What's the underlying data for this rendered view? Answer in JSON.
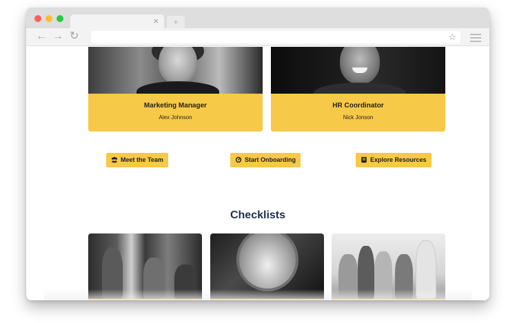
{
  "browser": {
    "tab_close": "×",
    "new_tab": "+",
    "nav": {
      "back": "←",
      "forward": "→",
      "reload": "↻"
    },
    "bookmark_icon": "☆"
  },
  "profiles": [
    {
      "title": "Marketing Manager",
      "name": "Alex Johnson"
    },
    {
      "title": "HR Coordinator",
      "name": "Nick Jonson"
    }
  ],
  "actions": [
    {
      "label": "Meet the Team",
      "icon": "users-icon"
    },
    {
      "label": "Start Onboarding",
      "icon": "gauge-icon"
    },
    {
      "label": "Explore Resources",
      "icon": "book-icon"
    }
  ],
  "checklists": {
    "heading": "Checklists"
  },
  "colors": {
    "accent": "#f7c948",
    "heading": "#1f2d4e"
  }
}
